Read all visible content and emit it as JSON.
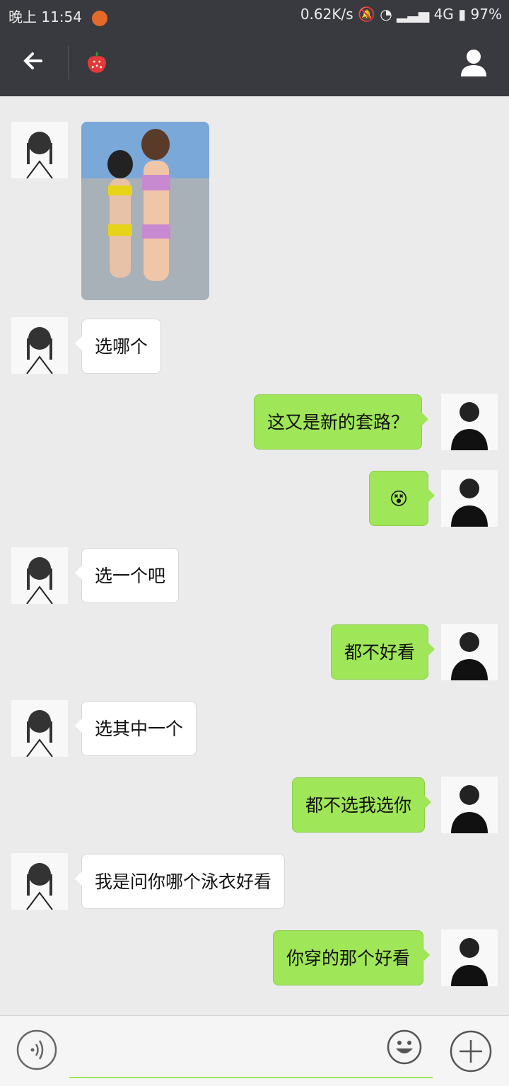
{
  "status_bar": {
    "time": "晚上 11:54",
    "network_speed": "0.62K/s",
    "network_type": "4G",
    "battery": "97%"
  },
  "header": {
    "title_icon": "strawberry-icon",
    "back_icon": "arrow-left-icon",
    "profile_icon": "person-icon"
  },
  "messages": [
    {
      "side": "left",
      "type": "image"
    },
    {
      "side": "left",
      "text": "选哪个"
    },
    {
      "side": "right",
      "text": "这又是新的套路？"
    },
    {
      "side": "right",
      "type": "emoji",
      "emoji": "😵"
    },
    {
      "side": "left",
      "text": "选一个吧"
    },
    {
      "side": "right",
      "text": "都不好看"
    },
    {
      "side": "left",
      "text": "选其中一个"
    },
    {
      "side": "right",
      "text": "都不选我选你"
    },
    {
      "side": "left",
      "text": "我是问你哪个泳衣好看"
    },
    {
      "side": "right",
      "text": "你穿的那个好看"
    }
  ],
  "input_bar": {
    "voice_icon": "voice-icon",
    "emoji_icon": "smile-icon",
    "plus_icon": "plus-icon"
  },
  "colors": {
    "header_bg": "#393a3f",
    "chat_bg": "#ebebeb",
    "sent_bubble": "#9fe658",
    "received_bubble": "#ffffff"
  }
}
